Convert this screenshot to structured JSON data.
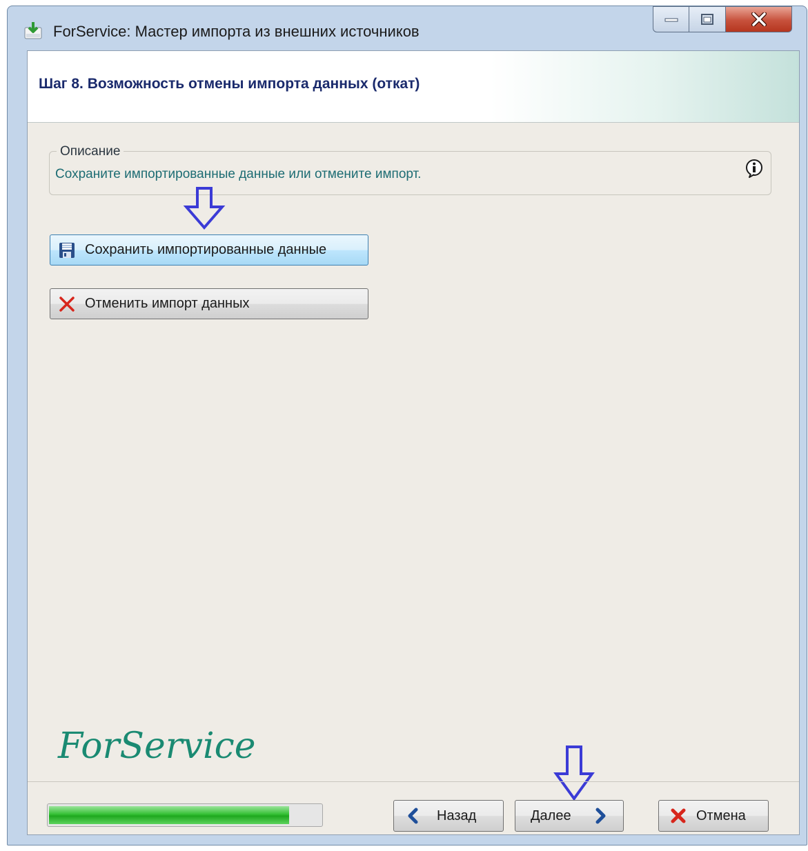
{
  "window": {
    "title": "ForService: Мастер импорта из внешних источников"
  },
  "header": {
    "step_title": "Шаг 8. Возможность отмены импорта данных (откат)"
  },
  "description": {
    "legend": "Описание",
    "text": "Сохраните импортированные данные или отмените импорт."
  },
  "actions": {
    "save_label": "Сохранить импортированные данные",
    "cancel_import_label": "Отменить импорт данных"
  },
  "logo": {
    "text": "ForService",
    "color": "#1a8a72"
  },
  "footer": {
    "progress_fraction": 0.88,
    "back_label": "Назад",
    "next_label": "Далее",
    "cancel_label": "Отмена"
  },
  "colors": {
    "header_title": "#1a2a6c",
    "description_text": "#1d6c73",
    "annotation_arrow": "#3b3bd6",
    "progress_green": "#22b022"
  },
  "icons": [
    "app-import-icon",
    "minimize-icon",
    "maximize-icon",
    "close-icon",
    "info-icon",
    "floppy-disk-icon",
    "red-x-icon",
    "chevron-left-icon",
    "chevron-right-icon",
    "down-arrow-annotation"
  ]
}
